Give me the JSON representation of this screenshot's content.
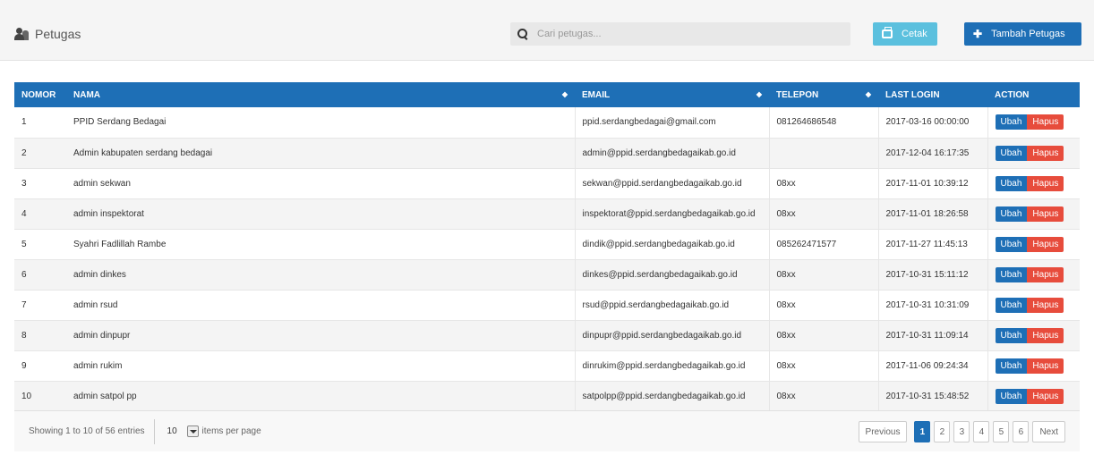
{
  "header": {
    "title": "Petugas",
    "search_placeholder": "Cari petugas...",
    "cetak_label": "Cetak",
    "tambah_label": "Tambah Petugas"
  },
  "table": {
    "columns": [
      "NOMOR",
      "NAMA",
      "EMAIL",
      "TELEPON",
      "LAST LOGIN",
      "ACTION"
    ],
    "rows": [
      {
        "no": "1",
        "nama": "PPID Serdang Bedagai",
        "email": "ppid.serdangbedagai@gmail.com",
        "telepon": "081264686548",
        "last_login": "2017-03-16 00:00:00"
      },
      {
        "no": "2",
        "nama": "Admin kabupaten serdang bedagai",
        "email": "admin@ppid.serdangbedagaikab.go.id",
        "telepon": "",
        "last_login": "2017-12-04 16:17:35"
      },
      {
        "no": "3",
        "nama": "admin sekwan",
        "email": "sekwan@ppid.serdangbedagaikab.go.id",
        "telepon": "08xx",
        "last_login": "2017-11-01 10:39:12"
      },
      {
        "no": "4",
        "nama": "admin inspektorat",
        "email": "inspektorat@ppid.serdangbedagaikab.go.id",
        "telepon": "08xx",
        "last_login": "2017-11-01 18:26:58"
      },
      {
        "no": "5",
        "nama": "Syahri Fadlillah Rambe",
        "email": "dindik@ppid.serdangbedagaikab.go.id",
        "telepon": "085262471577",
        "last_login": "2017-11-27 11:45:13"
      },
      {
        "no": "6",
        "nama": "admin dinkes",
        "email": "dinkes@ppid.serdangbedagaikab.go.id",
        "telepon": "08xx",
        "last_login": "2017-10-31 15:11:12"
      },
      {
        "no": "7",
        "nama": "admin rsud",
        "email": "rsud@ppid.serdangbedagaikab.go.id",
        "telepon": "08xx",
        "last_login": "2017-10-31 10:31:09"
      },
      {
        "no": "8",
        "nama": "admin dinpupr",
        "email": "dinpupr@ppid.serdangbedagaikab.go.id",
        "telepon": "08xx",
        "last_login": "2017-10-31 11:09:14"
      },
      {
        "no": "9",
        "nama": "admin rukim",
        "email": "dinrukim@ppid.serdangbedagaikab.go.id",
        "telepon": "08xx",
        "last_login": "2017-11-06 09:24:34"
      },
      {
        "no": "10",
        "nama": "admin satpol pp",
        "email": "satpolpp@ppid.serdangbedagaikab.go.id",
        "telepon": "08xx",
        "last_login": "2017-10-31 15:48:52"
      }
    ],
    "ubah_label": "Ubah",
    "hapus_label": "Hapus"
  },
  "footer": {
    "showing": "Showing 1 to 10 of 56 entries",
    "per_page_value": "10",
    "per_page_label": "items per page",
    "prev_label": "Previous",
    "next_label": "Next",
    "pages": [
      "1",
      "2",
      "3",
      "4",
      "5",
      "6"
    ],
    "active_page": "1"
  },
  "colors": {
    "primary": "#1e6fb6",
    "info": "#5bc0de",
    "danger": "#e74c3c"
  }
}
